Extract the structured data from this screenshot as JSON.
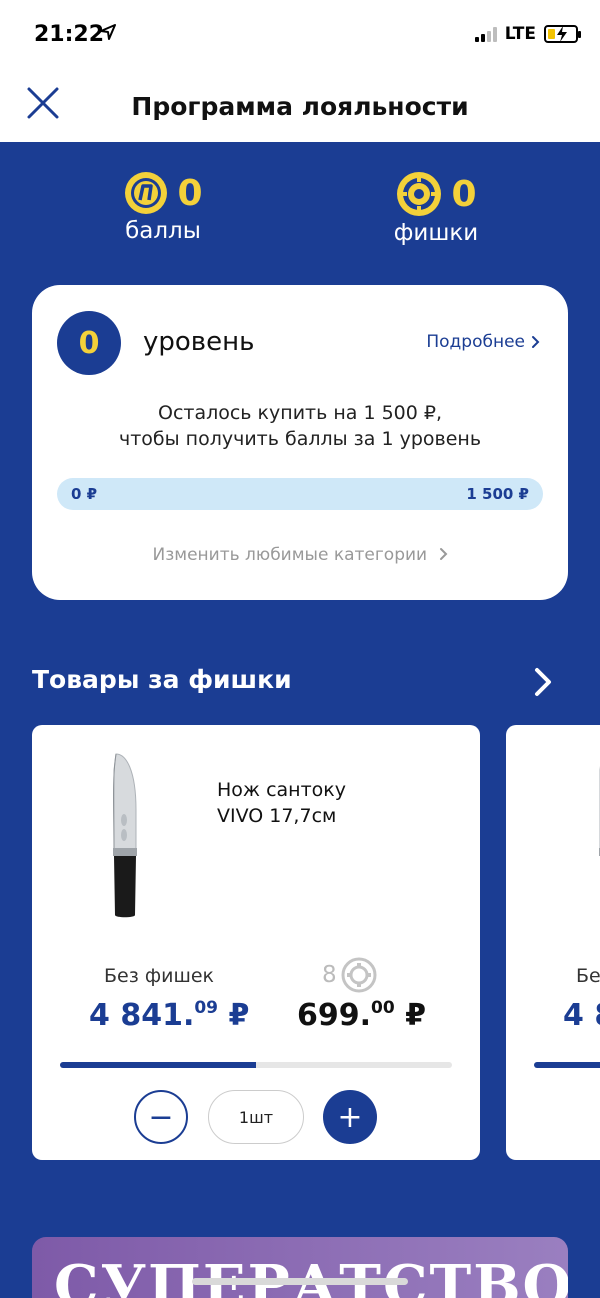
{
  "status_bar": {
    "time": "21:22",
    "network": "LTE"
  },
  "nav": {
    "title": "Программа лояльности"
  },
  "stats": {
    "points": {
      "value": "0",
      "label": "баллы",
      "icon": "points-coin-icon"
    },
    "chips": {
      "value": "0",
      "label": "фишки",
      "icon": "chip-coin-icon"
    }
  },
  "level_card": {
    "level": "0",
    "level_label": "уровень",
    "more_link": "Подробнее",
    "desc_line1": "Осталось купить на 1 500 ₽,",
    "desc_line2": "чтобы получить баллы за 1 уровень",
    "progress_min": "0 ₽",
    "progress_max": "1 500 ₽",
    "progress_fraction": 0,
    "change_categories": "Изменить любимые категории"
  },
  "section": {
    "title": "Товары за фишки"
  },
  "products": [
    {
      "name_line1": "Нож сантоку",
      "name_line2": "VIVO 17,7см",
      "no_chips_label": "Без фишек",
      "old_price_int": "4 841.",
      "old_price_dec": "09",
      "currency": "₽",
      "chips_required": "8",
      "new_price_int": "699.",
      "new_price_dec": "00",
      "progress_fraction": 0.5,
      "quantity": "1шт",
      "minus_label": "−",
      "plus_label": "+"
    },
    {
      "no_chips_label": "Бе",
      "old_price_int": "4 8"
    }
  ],
  "promo": {
    "text": "СУПЕРАТСТВО"
  },
  "colors": {
    "brand_blue": "#1b3d93",
    "accent_yellow": "#f3d13a",
    "progress_bg": "#cfe8f8"
  }
}
